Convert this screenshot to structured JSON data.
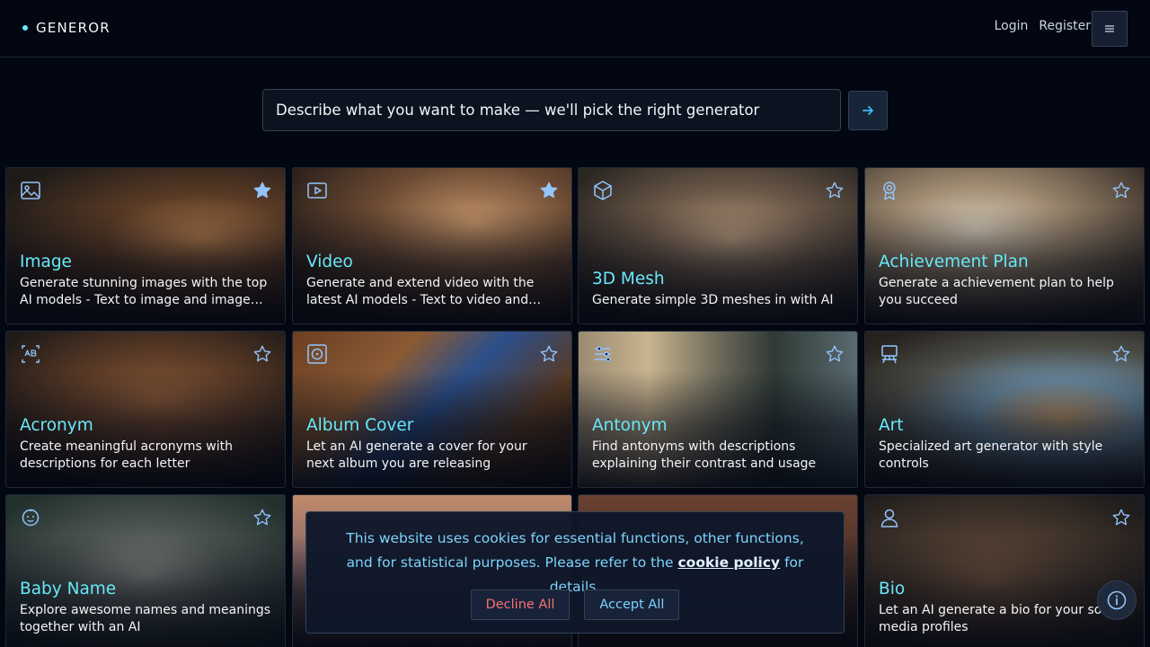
{
  "header": {
    "brand": "GENEROR",
    "login": "Login",
    "register": "Register"
  },
  "search": {
    "placeholder": "Describe what you want to make — we'll pick the right generator"
  },
  "cards": [
    {
      "title": "Image",
      "desc": "Generate stunning images with the top AI models - Text to image and image to...",
      "icon": "image-icon",
      "starred": true
    },
    {
      "title": "Video",
      "desc": "Generate and extend video with the latest AI models - Text to video and image to...",
      "icon": "video-icon",
      "starred": true
    },
    {
      "title": "3D Mesh",
      "desc": "Generate simple 3D meshes in with AI",
      "icon": "cube-icon",
      "starred": false
    },
    {
      "title": "Achievement Plan",
      "desc": "Generate a achievement plan to help you succeed",
      "icon": "award-icon",
      "starred": false
    },
    {
      "title": "Acronym",
      "desc": "Create meaningful acronyms with descriptions for each letter",
      "icon": "abc-icon",
      "starred": false
    },
    {
      "title": "Album Cover",
      "desc": "Let an AI generate a cover for your next album you are releasing",
      "icon": "disc-icon",
      "starred": false
    },
    {
      "title": "Antonym",
      "desc": "Find antonyms with descriptions explaining their contrast and usage",
      "icon": "sliders-icon",
      "starred": false
    },
    {
      "title": "Art",
      "desc": "Specialized art generator with style controls",
      "icon": "easel-icon",
      "starred": false
    },
    {
      "title": "Baby Name",
      "desc": "Explore awesome names and meanings together with an AI",
      "icon": "baby-icon",
      "starred": false
    },
    {
      "title": "",
      "desc": "",
      "icon": "image-icon",
      "starred": false
    },
    {
      "title": "",
      "desc": "",
      "icon": "chat-icon",
      "starred": false
    },
    {
      "title": "Bio",
      "desc": "Let an AI generate a bio for your social media profiles",
      "icon": "user-icon",
      "starred": false
    }
  ],
  "cookie": {
    "text_before": "This website uses cookies for essential functions, other functions, and for statistical purposes. Please refer to the ",
    "link": "cookie policy",
    "text_after": " for details.",
    "decline": "Decline All",
    "accept": "Accept All"
  },
  "colors": {
    "accent": "#67e8f9",
    "background": "#030712",
    "decline": "#f87171"
  }
}
